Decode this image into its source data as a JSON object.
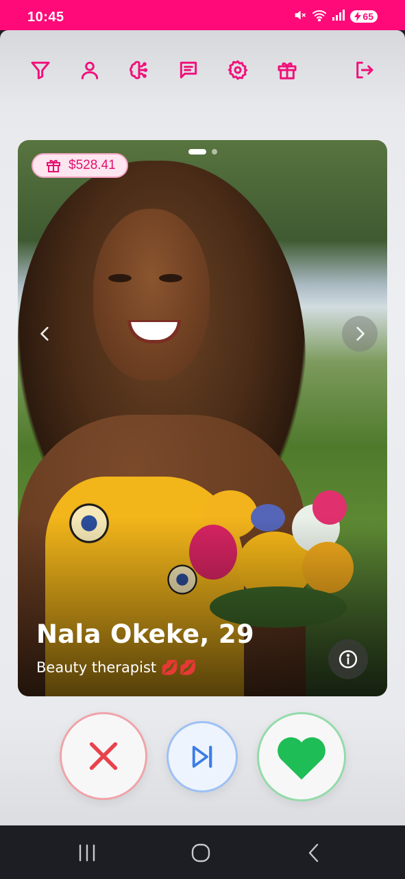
{
  "status_bar": {
    "time": "10:45",
    "battery": "65",
    "icons": [
      "mute-icon",
      "wifi-icon",
      "signal-icon",
      "battery-charging-icon"
    ]
  },
  "toolbar": {
    "icons": [
      "filter-icon",
      "profile-icon",
      "brain-icon",
      "chat-icon",
      "settings-icon",
      "gift-icon",
      "logout-icon"
    ],
    "accent_color": "#f0107a"
  },
  "card": {
    "gift_amount": "$528.41",
    "photo_count": 2,
    "current_photo": 1,
    "name_age": "Nala Okeke, 29",
    "occupation": "Beauty therapist 💋💋"
  },
  "actions": {
    "nope_color": "#e8434b",
    "skip_color": "#3a7de6",
    "like_color": "#1fbd56"
  },
  "colors": {
    "status_bar": "#ff0a78",
    "nav_bar": "#1d1e24"
  }
}
